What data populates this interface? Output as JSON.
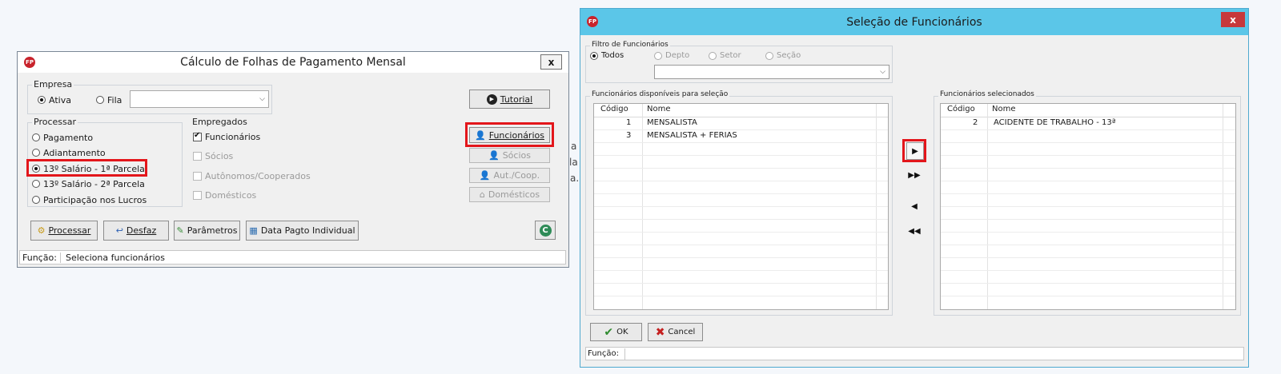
{
  "background_text": [
    "a",
    "la",
    "a."
  ],
  "left_window": {
    "title": "Cálculo de Folhas de Pagamento Mensal",
    "logo": "FP",
    "close": "x",
    "empresa": {
      "label": "Empresa",
      "ativa": "Ativa",
      "fila": "Fila"
    },
    "tutorial_button": "Tutorial",
    "processar": {
      "label": "Processar",
      "options": [
        "Pagamento",
        "Adiantamento",
        "13º Salário - 1ª Parcela",
        "13º Salário - 2ª Parcela",
        "Participação nos Lucros"
      ],
      "selected": "13º Salário - 1ª Parcela"
    },
    "empregados": {
      "label": "Empregados",
      "funcionarios": "Funcionários",
      "socios": "Sócios",
      "autonomos": "Autônomos/Cooperados",
      "domesticos": "Domésticos"
    },
    "side_buttons": {
      "funcionarios": "Funcionários",
      "socios": "Sócios",
      "aut_coop": "Aut./Coop.",
      "domesticos": "Domésticos"
    },
    "toolbar": {
      "processar": "Processar",
      "desfaz": "Desfaz",
      "parametros": "Parâmetros",
      "data_pagto": "Data Pagto Individual"
    },
    "status": {
      "label": "Função:",
      "value": "Seleciona funcionários"
    }
  },
  "right_window": {
    "title": "Seleção de Funcionários",
    "logo": "FP",
    "close": "x",
    "filtro": {
      "label": "Filtro de Funcionários",
      "options": [
        "Todos",
        "Depto",
        "Setor",
        "Seção"
      ],
      "selected": "Todos"
    },
    "disponiveis": {
      "label": "Funcionários disponíveis para seleção",
      "columns": [
        "Código",
        "Nome"
      ],
      "rows": [
        {
          "codigo": "1",
          "nome": "MENSALISTA"
        },
        {
          "codigo": "3",
          "nome": "MENSALISTA + FERIAS"
        }
      ]
    },
    "selecionados": {
      "label": "Funcionários selecionados",
      "columns": [
        "Código",
        "Nome"
      ],
      "rows": [
        {
          "codigo": "2",
          "nome": "ACIDENTE DE TRABALHO - 13ª"
        }
      ]
    },
    "transfer_icons": [
      "move-right-icon",
      "move-all-right-icon",
      "move-left-icon",
      "move-all-left-icon"
    ],
    "ok_button": "OK",
    "cancel_button": "Cancel",
    "status_label": "Função:"
  },
  "colors": {
    "highlight": "#e3161b",
    "right_titlebar": "#5bc6e8",
    "close_red": "#c7383b",
    "logo_red": "#c8232c"
  }
}
